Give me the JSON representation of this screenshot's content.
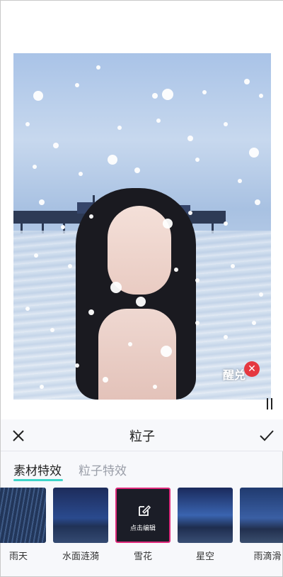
{
  "preview": {
    "watermark": "醒兑",
    "colors": {
      "sky": "#a9c3e7",
      "hair": "#1a1a20",
      "remove": "#e53840"
    }
  },
  "panel": {
    "title": "粒子",
    "close_icon": "close-icon",
    "confirm_icon": "check-icon"
  },
  "tabs": [
    {
      "label": "素材特效",
      "active": true
    },
    {
      "label": "粒子特效",
      "active": false
    }
  ],
  "effects": [
    {
      "label": "雨天",
      "theme": "rain"
    },
    {
      "label": "水面涟漪",
      "theme": "night-sky"
    },
    {
      "label": "雪花",
      "theme": "selected",
      "edit_label": "点击编辑"
    },
    {
      "label": "星空",
      "theme": "starry"
    },
    {
      "label": "雨滴滑",
      "theme": "rain-drops"
    }
  ],
  "accent_colors": {
    "tab_underline": "#3fd5c9",
    "selection_border": "#e02a7c"
  }
}
